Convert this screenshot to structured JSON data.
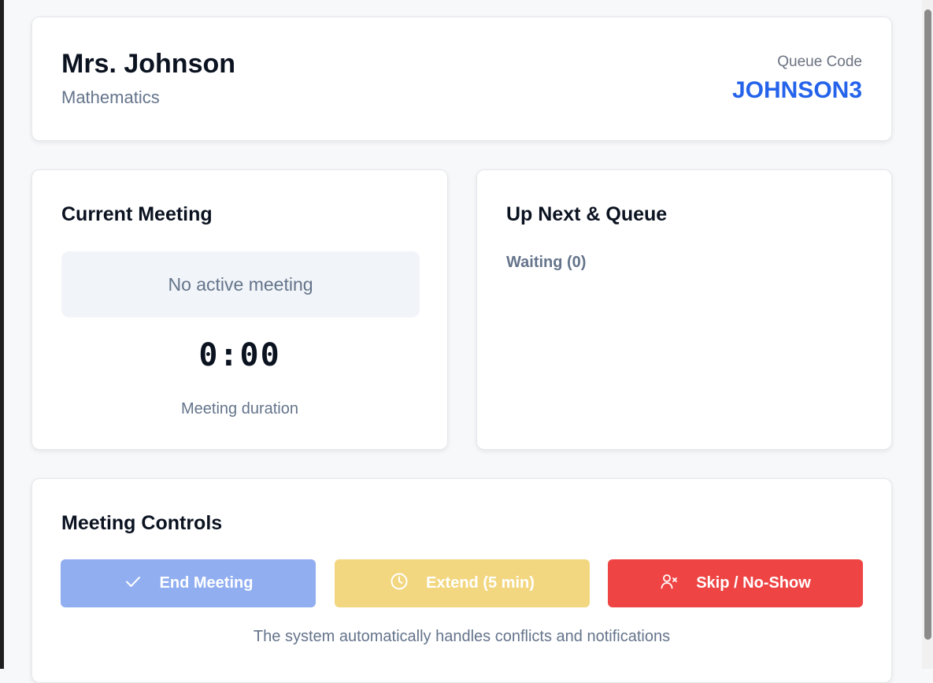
{
  "header": {
    "teacher_name": "Mrs. Johnson",
    "subject": "Mathematics",
    "queue_code_label": "Queue Code",
    "queue_code": "JOHNSON3"
  },
  "current_meeting": {
    "title": "Current Meeting",
    "status": "No active meeting",
    "timer": "0:00",
    "duration_label": "Meeting duration"
  },
  "queue": {
    "title": "Up Next & Queue",
    "waiting_label": "Waiting (0)"
  },
  "controls": {
    "title": "Meeting Controls",
    "end_label": "End Meeting",
    "extend_label": "Extend (5 min)",
    "skip_label": "Skip / No-Show",
    "note": "The system automatically handles conflicts and notifications"
  },
  "icons": {
    "end": "check-icon",
    "extend": "clock-icon",
    "skip": "user-x-icon"
  },
  "colors": {
    "accent": "#2563eb",
    "end_button": "#91aef0",
    "extend_button": "#f2d780",
    "skip_button": "#ef4444"
  }
}
